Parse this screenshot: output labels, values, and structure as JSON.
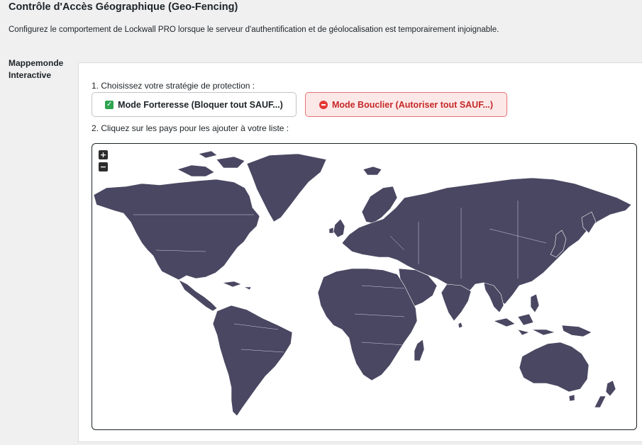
{
  "header": {
    "title": "Contrôle d'Accès Géographique (Geo-Fencing)",
    "description": "Configurez le comportement de Lockwall PRO lorsque le serveur d'authentification et de géolocalisation est temporairement injoignable."
  },
  "section": {
    "label": "Mappemonde Interactive",
    "step1_label": "1. Choisissez votre stratégie de protection :",
    "step2_label": "2. Cliquez sur les pays pour les ajouter à votre liste :"
  },
  "modes": {
    "fortress": {
      "label": "Mode Forteresse (Bloquer tout SAUF...)",
      "icon": "check-box-icon",
      "selected": false
    },
    "shield": {
      "label": "Mode Bouclier (Autoriser tout SAUF...)",
      "icon": "no-entry-icon",
      "selected": true
    }
  },
  "map": {
    "zoom_in": "+",
    "zoom_out": "−",
    "land_color": "#4a4762",
    "background_color": "#ffffff"
  }
}
